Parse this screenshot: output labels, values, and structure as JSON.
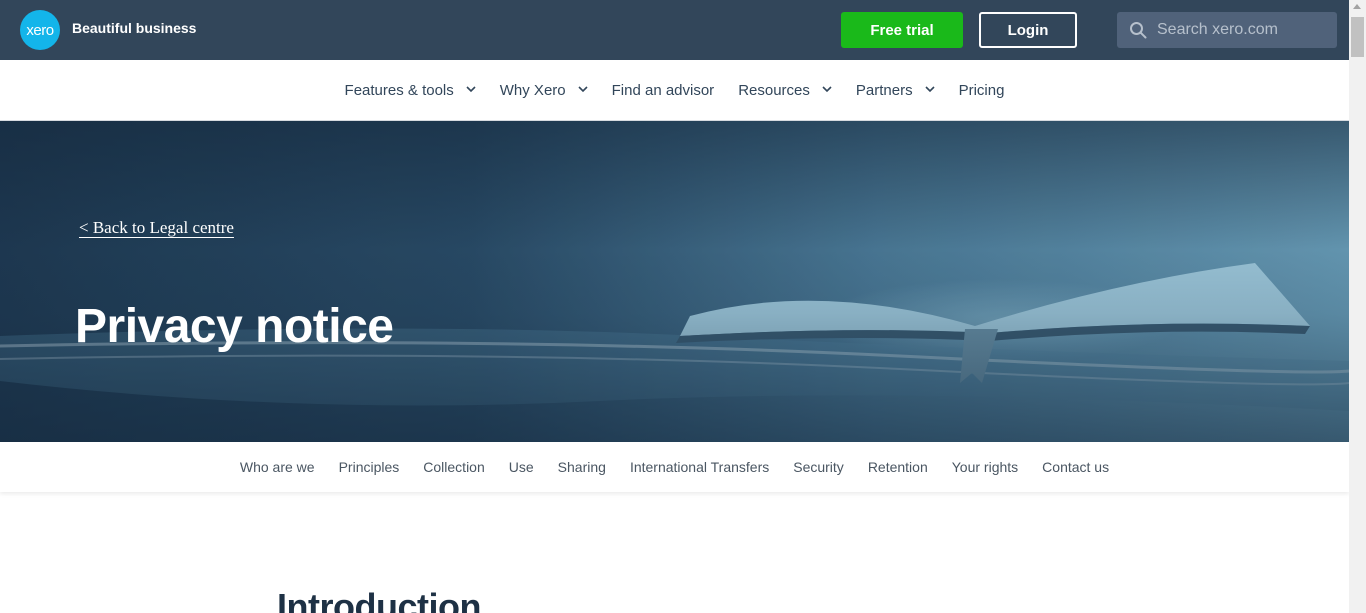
{
  "header": {
    "logo_text": "xero",
    "tagline": "Beautiful business",
    "free_trial_label": "Free trial",
    "login_label": "Login",
    "search_placeholder": "Search xero.com"
  },
  "main_nav": {
    "items": [
      {
        "label": "Features & tools",
        "has_dropdown": true
      },
      {
        "label": "Why Xero",
        "has_dropdown": true
      },
      {
        "label": "Find an advisor",
        "has_dropdown": false
      },
      {
        "label": "Resources",
        "has_dropdown": true
      },
      {
        "label": "Partners",
        "has_dropdown": true
      },
      {
        "label": "Pricing",
        "has_dropdown": false
      }
    ]
  },
  "hero": {
    "back_link": "< Back to Legal centre",
    "title": "Privacy notice"
  },
  "sub_nav": {
    "items": [
      "Who are we",
      "Principles",
      "Collection",
      "Use",
      "Sharing",
      "International Transfers",
      "Security",
      "Retention",
      "Your rights",
      "Contact us"
    ]
  },
  "content": {
    "heading": "Introduction"
  },
  "colors": {
    "header_bg": "#32465a",
    "brand_blue": "#13b5ea",
    "trial_green": "#1ab91a"
  },
  "icons": {
    "search": "search-icon",
    "dropdown": "chevron-down-icon"
  }
}
